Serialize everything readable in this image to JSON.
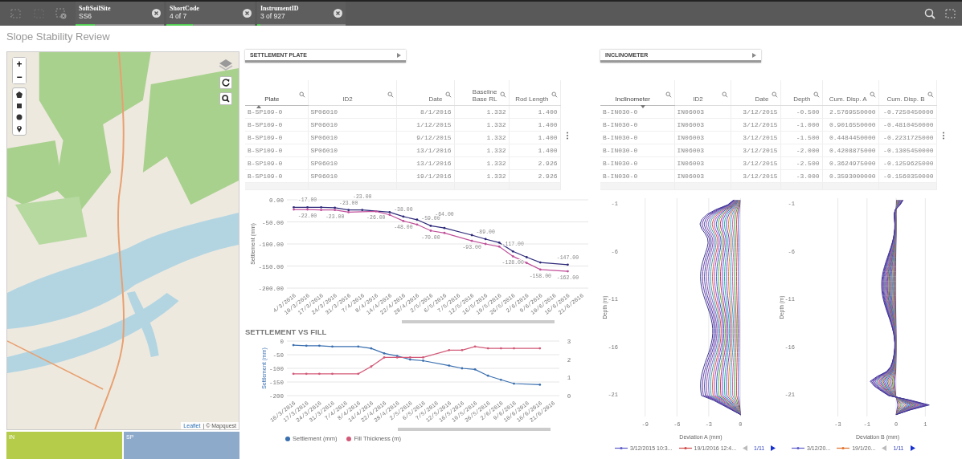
{
  "filter_bar": {
    "chips": [
      {
        "label": "SoftSoilSite",
        "value": "SS6",
        "level": 0.22
      },
      {
        "label": "ShortCode",
        "value": "4 of 7",
        "level": 0.3
      },
      {
        "label": "InstrumentID",
        "value": "3 of 927",
        "level": 0.04
      }
    ]
  },
  "sheet_title": "Slope Stability Review",
  "map": {
    "zoom_buttons": [
      "+",
      "−"
    ],
    "attribution_link": "Leaflet",
    "attribution_text": "| © Mapquest"
  },
  "map_legend": [
    {
      "label": "IN",
      "color": "#b4cc4a"
    },
    {
      "label": "SP",
      "color": "#8eaacb"
    }
  ],
  "settlement": {
    "dropdown": "SETTLEMENT PLATE",
    "table": {
      "columns": [
        {
          "label": "Plate",
          "sorted": true,
          "descending": false
        },
        {
          "label": "ID2",
          "sorted": false
        },
        {
          "label": "Date",
          "sorted": false
        },
        {
          "label": "Baseline Base RL",
          "sorted": false
        },
        {
          "label": "Rod Length",
          "sorted": false
        }
      ],
      "rows": [
        [
          "B-SP109-0",
          "SP06010",
          "8/1/2016",
          "1.332",
          "1.400"
        ],
        [
          "B-SP109-0",
          "SP06010",
          "1/12/2015",
          "1.332",
          "1.400"
        ],
        [
          "B-SP109-0",
          "SP06010",
          "9/12/2015",
          "1.332",
          "1.400"
        ],
        [
          "B-SP109-0",
          "SP06010",
          "13/1/2016",
          "1.332",
          "1.400"
        ],
        [
          "B-SP109-0",
          "SP06010",
          "13/1/2016",
          "1.332",
          "2.926"
        ],
        [
          "B-SP109-0",
          "SP06010",
          "19/1/2016",
          "1.332",
          "2.926"
        ]
      ]
    },
    "chart_data": {
      "type": "line",
      "ylabel": "Settlement (mm)",
      "grid": true,
      "categories": [
        "4/3/2016",
        "10/3/2016",
        "17/3/2016",
        "24/3/2016",
        "31/3/2016",
        "7/4/2016",
        "8/4/2016",
        "14/4/2016",
        "22/4/2016",
        "28/4/2016",
        "2/5/2016",
        "6/5/2016",
        "7/5/2016",
        "12/5/2016",
        "16/5/2016",
        "19/5/2016",
        "26/5/2016",
        "2/6/2016",
        "9/6/2016",
        "10/6/2016",
        "16/6/2016",
        "21/6/2016"
      ],
      "series": [
        {
          "color": "#2e2a7a",
          "values": [
            -17,
            -17,
            -17,
            -18,
            -23,
            -23,
            null,
            -28,
            -38,
            -45,
            -59,
            -64,
            null,
            -80,
            -89,
            -97,
            -117,
            -130,
            -142,
            null,
            -147,
            null
          ]
        },
        {
          "color": "#c0509a",
          "values": [
            -22,
            -22,
            -23,
            -23,
            -28,
            null,
            -26,
            -34,
            -48,
            -56,
            -70,
            -75,
            null,
            -93,
            -100,
            -106,
            -128,
            -143,
            -158,
            null,
            -162,
            null
          ]
        }
      ],
      "ylim": [
        -200,
        0
      ],
      "yticks": [
        {
          "value": 0,
          "label": "0.00"
        },
        {
          "value": -50,
          "label": "-50.00"
        },
        {
          "value": -100,
          "label": "-100.00"
        },
        {
          "value": -150,
          "label": "-150.00"
        },
        {
          "value": -200,
          "label": "-200.00"
        }
      ],
      "annotations": [
        {
          "x": "10/3/2016",
          "y": -17,
          "text": "-17.00"
        },
        {
          "x": "31/3/2016",
          "y": -23,
          "text": "-23.00"
        },
        {
          "x": "7/4/2016",
          "y": -23,
          "text": "-23.00"
        },
        {
          "x": "22/4/2016",
          "y": -38,
          "text": "-38.00"
        },
        {
          "x": "2/5/2016",
          "y": -59,
          "text": "-59.00"
        },
        {
          "x": "6/5/2016",
          "y": -64,
          "text": "-64.00"
        },
        {
          "x": "16/5/2016",
          "y": -89,
          "text": "-89.00"
        },
        {
          "x": "26/5/2016",
          "y": -117,
          "text": "-117.00"
        },
        {
          "x": "16/6/2016",
          "y": -147,
          "text": "-147.00"
        },
        {
          "x": "10/3/2016",
          "y": -22,
          "text": "-22.00"
        },
        {
          "x": "24/3/2016",
          "y": -23,
          "text": "-23.00"
        },
        {
          "x": "8/4/2016",
          "y": -26,
          "text": "-26.00"
        },
        {
          "x": "22/4/2016",
          "y": -48,
          "text": "-48.00"
        },
        {
          "x": "2/5/2016",
          "y": -70,
          "text": "-70.00"
        },
        {
          "x": "12/5/2016",
          "y": -93,
          "text": "-93.00"
        },
        {
          "x": "26/5/2016",
          "y": -128,
          "text": "-128.00"
        },
        {
          "x": "9/6/2016",
          "y": -158,
          "text": "-158.00"
        },
        {
          "x": "16/6/2016",
          "y": -162,
          "text": "-162.00"
        }
      ]
    }
  },
  "settlement_vs_fill": {
    "title": "SETTLEMENT VS FILL",
    "chart_data": {
      "type": "line",
      "ylabel": "Settlement (mm)",
      "grid": true,
      "categories": [
        "10/3/2016",
        "17/3/2016",
        "24/3/2016",
        "31/3/2016",
        "7/4/2016",
        "8/4/2016",
        "14/4/2016",
        "22/4/2016",
        "28/4/2016",
        "2/5/2016",
        "6/5/2016",
        "7/5/2016",
        "12/5/2016",
        "16/5/2016",
        "19/5/2016",
        "26/5/2016",
        "2/6/2016",
        "9/6/2016",
        "10/6/2016",
        "16/6/2016",
        "21/6/2016"
      ],
      "series": [
        {
          "name": "Settlement (mm)",
          "color": "#3a6fb0",
          "values": [
            -15,
            -17,
            -17,
            -20,
            null,
            -20,
            -27,
            -45,
            -55,
            -68,
            -72,
            null,
            -90,
            -100,
            -104,
            -127,
            -142,
            -156,
            null,
            -160,
            null
          ]
        },
        {
          "name": "Fill Thickness (m)",
          "color": "#d25a78",
          "axis": "y2",
          "values": [
            1.2,
            1.2,
            1.2,
            1.2,
            null,
            1.2,
            1.6,
            2.1,
            2.1,
            2.1,
            2.1,
            null,
            2.5,
            2.5,
            2.7,
            2.6,
            2.6,
            2.6,
            null,
            2.6,
            null
          ]
        }
      ],
      "ylim": [
        -200,
        0
      ],
      "yticks": [
        0,
        -50,
        -100,
        -150,
        -200
      ],
      "y2lim": [
        0,
        3
      ],
      "y2ticks": [
        0,
        1,
        2,
        3
      ]
    }
  },
  "inclinometer": {
    "dropdown": "INCLINOMETER",
    "table": {
      "columns": [
        {
          "label": "Inclinometer",
          "sorted": true,
          "descending": true
        },
        {
          "label": "ID2",
          "sorted": false
        },
        {
          "label": "Date",
          "sorted": false
        },
        {
          "label": "Depth",
          "sorted": false
        },
        {
          "label": "Cum. Disp. A",
          "sorted": false
        },
        {
          "label": "Cum. Disp. B",
          "sorted": false
        }
      ],
      "rows": [
        [
          "B-IN030-0",
          "IN06003",
          "3/12/2015",
          "-0.500",
          "2.5769550000",
          "-0.7250450000"
        ],
        [
          "B-IN030-0",
          "IN06003",
          "3/12/2015",
          "-1.000",
          "0.9016550000",
          "-0.4810450000"
        ],
        [
          "B-IN030-0",
          "IN06003",
          "3/12/2015",
          "-1.500",
          "0.4484450000",
          "-0.2231725000"
        ],
        [
          "B-IN030-0",
          "IN06003",
          "3/12/2015",
          "-2.000",
          "0.4208875000",
          "-0.1305450000"
        ],
        [
          "B-IN030-0",
          "IN06003",
          "3/12/2015",
          "-2.500",
          "0.3624975000",
          "-0.1259625000"
        ],
        [
          "B-IN030-0",
          "IN06003",
          "3/12/2015",
          "-3.000",
          "0.3593000000",
          "-0.1560350000"
        ]
      ]
    },
    "profiles": [
      {
        "kind": "a",
        "ylabel": "Depth (m)",
        "yticks": [
          "-1",
          "-6",
          "-11",
          "-16",
          "-21"
        ],
        "xticks": [
          "-9",
          "-6",
          "-3",
          "0"
        ],
        "xlabel": "Deviation A (mm)",
        "legend": [
          {
            "label": "3/12/2015 10:3...",
            "color": "#5a5ac8"
          },
          {
            "label": "19/1/2016 12:4...",
            "color": "#d04848"
          }
        ],
        "page": "1/11"
      },
      {
        "kind": "b",
        "ylabel": "Depth (m)",
        "yticks": [
          "-1",
          "-6",
          "-11",
          "-16",
          "-21"
        ],
        "xticks": [
          "-3",
          "-1",
          "0",
          "1"
        ],
        "xlabel": "Deviation B (mm)",
        "legend": [
          {
            "label": "3/12/20...",
            "color": "#5a5ac8"
          },
          {
            "label": "19/1/20...",
            "color": "#e0702a"
          }
        ],
        "page": "1/11"
      }
    ]
  }
}
